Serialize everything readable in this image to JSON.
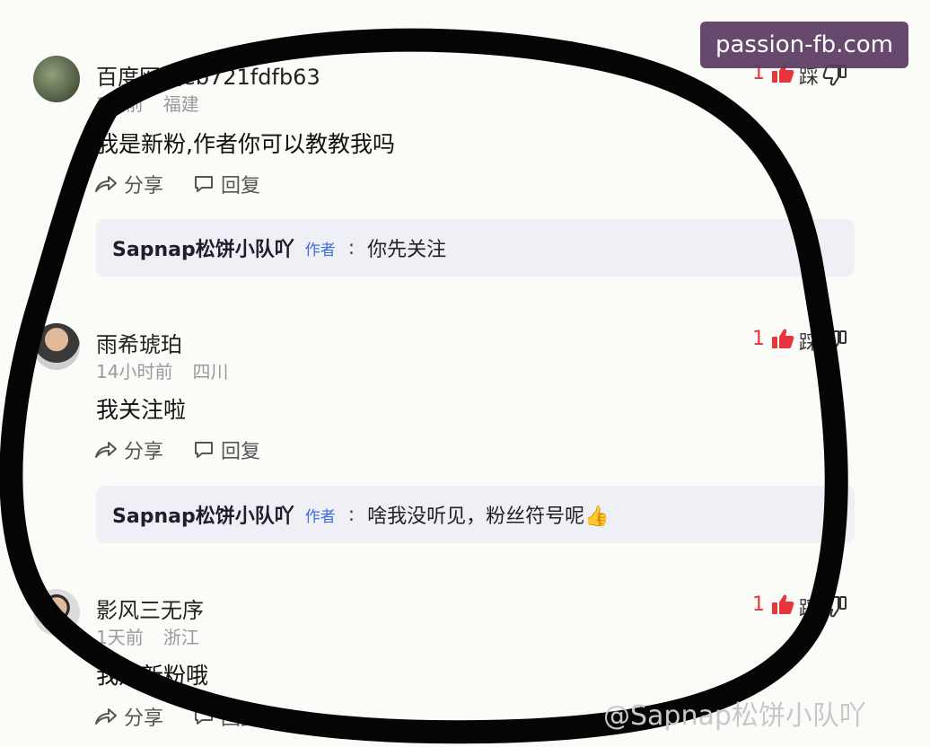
{
  "comments": [
    {
      "username": "百度网友eb721fdfb63",
      "time": "1天前",
      "location": "福建",
      "text": "我是新粉,作者你可以教教我吗",
      "share_label": "分享",
      "reply_label": "回复",
      "likes": "1",
      "dislike_label": "踩",
      "reply_item": {
        "author": "Sapnap松饼小队吖",
        "badge": "作者",
        "separator": ":",
        "text": "你先关注"
      }
    },
    {
      "username": "雨希琥珀",
      "time": "14小时前",
      "location": "四川",
      "text": "我关注啦",
      "share_label": "分享",
      "reply_label": "回复",
      "likes": "1",
      "dislike_label": "踩",
      "reply_item": {
        "author": "Sapnap松饼小队吖",
        "badge": "作者",
        "separator": ":",
        "text": "啥我没听见，粉丝符号呢👍"
      }
    },
    {
      "username": "影风三无序",
      "time": "1天前",
      "location": "浙江",
      "text": "我是新粉哦",
      "share_label": "分享",
      "reply_label": "回复",
      "likes": "1",
      "dislike_label": "踩"
    }
  ],
  "watermark_top": "passion-fb.com",
  "watermark_bottom": "@Sapnap松饼小队吖",
  "colors": {
    "like": "#e8353b",
    "badge": "#3d6be0",
    "reply_bg": "#eff0f6",
    "scribble": "#050505"
  }
}
